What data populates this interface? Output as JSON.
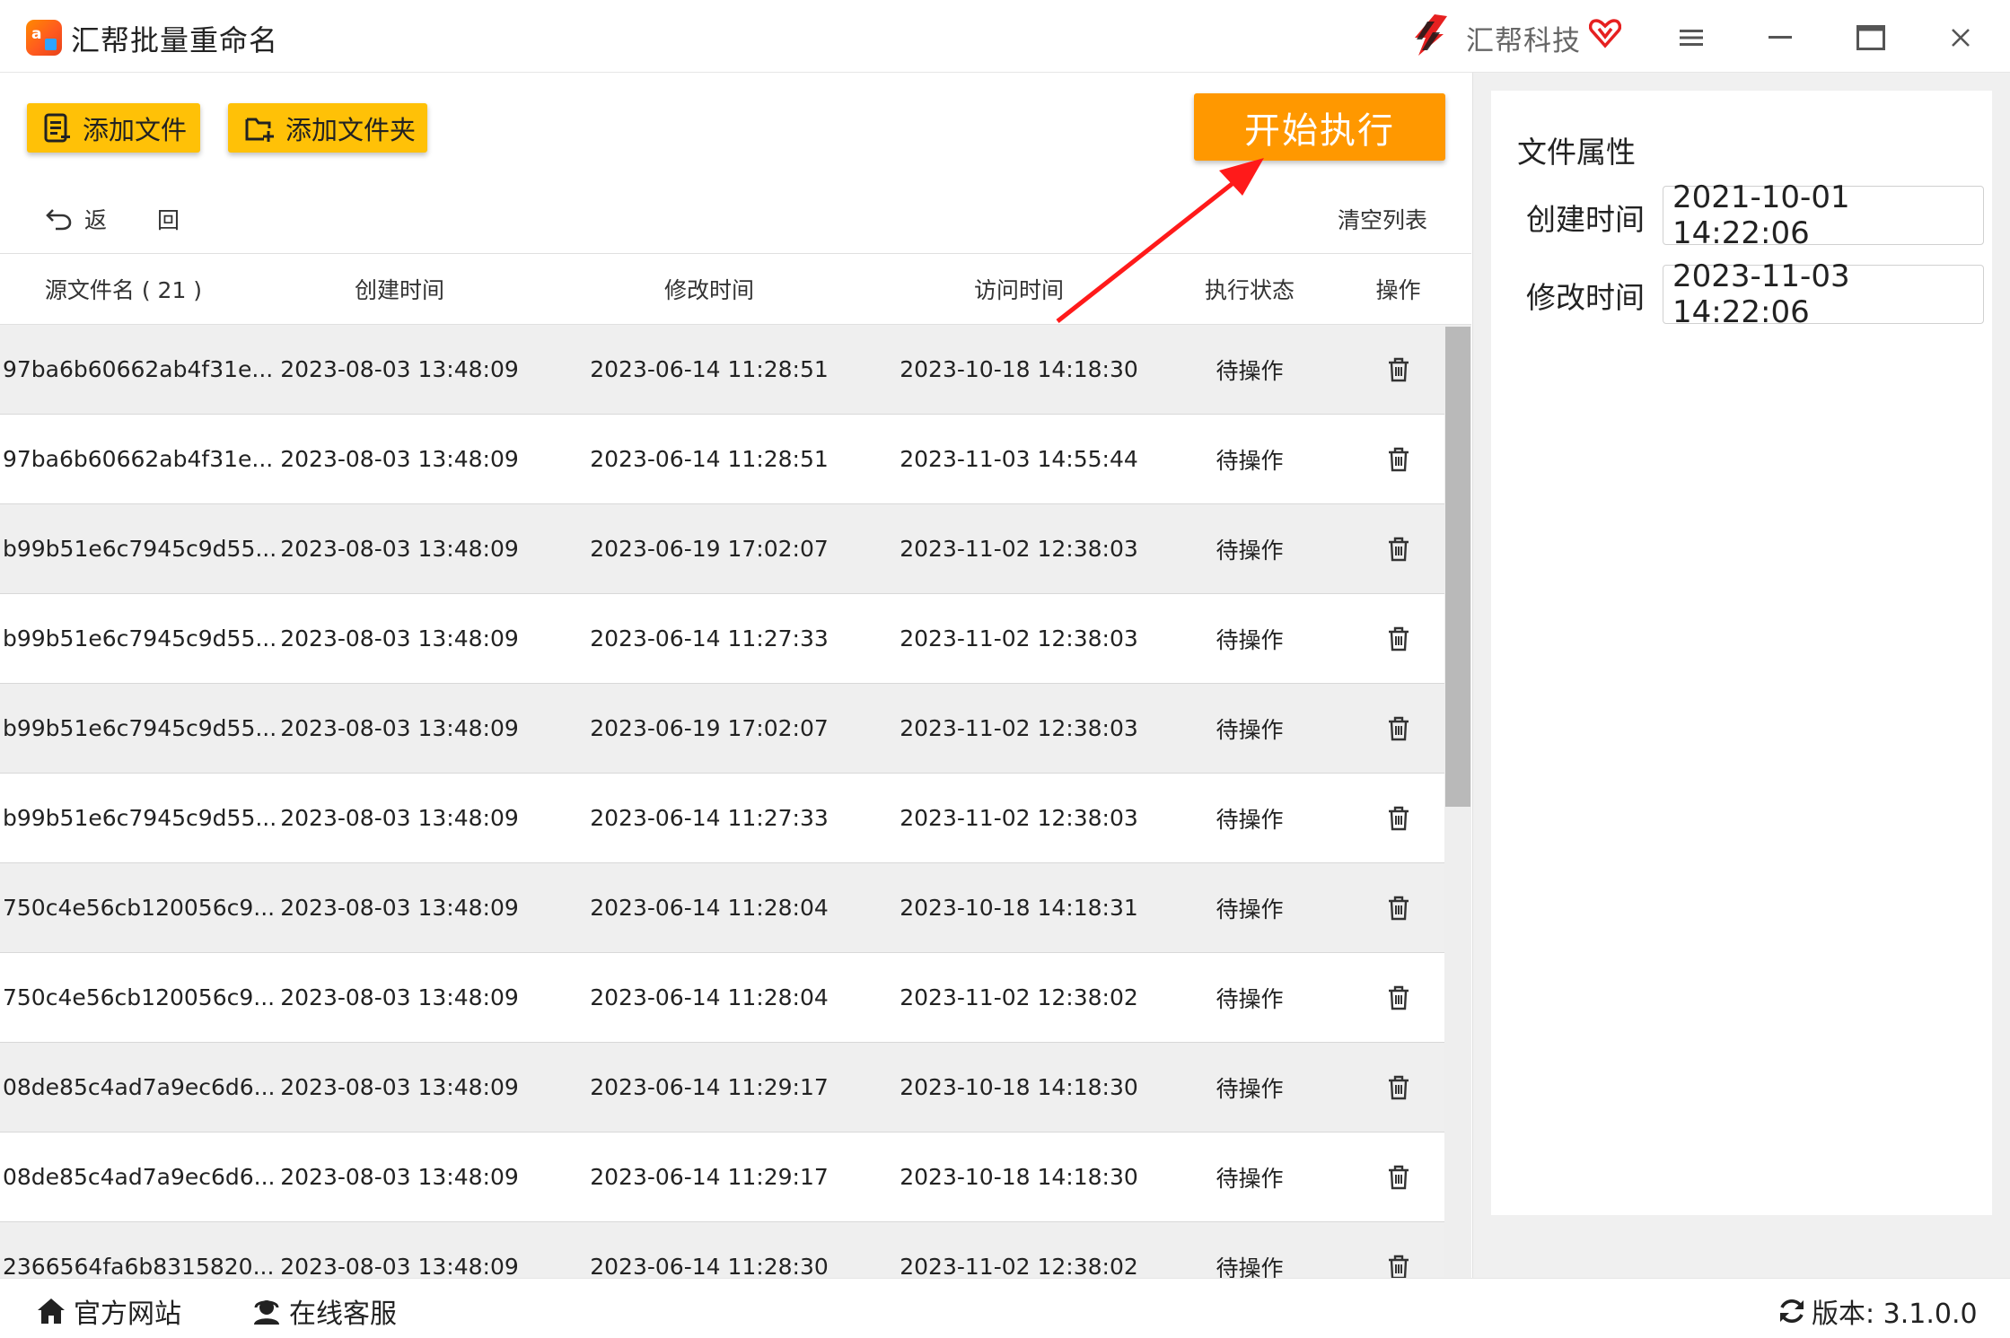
{
  "app": {
    "title": "汇帮批量重命名",
    "brand": "汇帮科技"
  },
  "toolbar": {
    "add_file": "添加文件",
    "add_folder": "添加文件夹",
    "start": "开始执行",
    "back": "返 回",
    "clear_list": "清空列表"
  },
  "table": {
    "columns": [
      "源文件名 ( 21 )",
      "创建时间",
      "修改时间",
      "访问时间",
      "执行状态",
      "操作"
    ],
    "rows": [
      {
        "name": "97ba6b60662ab4f31e...",
        "created": "2023-08-03 13:48:09",
        "modified": "2023-06-14 11:28:51",
        "accessed": "2023-10-18 14:18:30",
        "status": "待操作"
      },
      {
        "name": "97ba6b60662ab4f31e...",
        "created": "2023-08-03 13:48:09",
        "modified": "2023-06-14 11:28:51",
        "accessed": "2023-11-03 14:55:44",
        "status": "待操作"
      },
      {
        "name": "b99b51e6c7945c9d55...",
        "created": "2023-08-03 13:48:09",
        "modified": "2023-06-19 17:02:07",
        "accessed": "2023-11-02 12:38:03",
        "status": "待操作"
      },
      {
        "name": "b99b51e6c7945c9d55...",
        "created": "2023-08-03 13:48:09",
        "modified": "2023-06-14 11:27:33",
        "accessed": "2023-11-02 12:38:03",
        "status": "待操作"
      },
      {
        "name": "b99b51e6c7945c9d55...",
        "created": "2023-08-03 13:48:09",
        "modified": "2023-06-19 17:02:07",
        "accessed": "2023-11-02 12:38:03",
        "status": "待操作"
      },
      {
        "name": "b99b51e6c7945c9d55...",
        "created": "2023-08-03 13:48:09",
        "modified": "2023-06-14 11:27:33",
        "accessed": "2023-11-02 12:38:03",
        "status": "待操作"
      },
      {
        "name": "750c4e56cb120056c9...",
        "created": "2023-08-03 13:48:09",
        "modified": "2023-06-14 11:28:04",
        "accessed": "2023-10-18 14:18:31",
        "status": "待操作"
      },
      {
        "name": "750c4e56cb120056c9...",
        "created": "2023-08-03 13:48:09",
        "modified": "2023-06-14 11:28:04",
        "accessed": "2023-11-02 12:38:02",
        "status": "待操作"
      },
      {
        "name": "08de85c4ad7a9ec6d6...",
        "created": "2023-08-03 13:48:09",
        "modified": "2023-06-14 11:29:17",
        "accessed": "2023-10-18 14:18:30",
        "status": "待操作"
      },
      {
        "name": "08de85c4ad7a9ec6d6...",
        "created": "2023-08-03 13:48:09",
        "modified": "2023-06-14 11:29:17",
        "accessed": "2023-10-18 14:18:30",
        "status": "待操作"
      },
      {
        "name": "2366564fa6b8315820...",
        "created": "2023-08-03 13:48:09",
        "modified": "2023-06-14 11:28:30",
        "accessed": "2023-11-02 12:38:02",
        "status": "待操作"
      }
    ]
  },
  "properties": {
    "title": "文件属性",
    "created_label": "创建时间",
    "created_value": "2021-10-01 14:22:06",
    "modified_label": "修改时间",
    "modified_value": "2023-11-03 14:22:06"
  },
  "footer": {
    "website": "官方网站",
    "support": "在线客服",
    "version": "版本:  3.1.0.0"
  },
  "colors": {
    "accent_yellow": "#ffc107",
    "accent_orange": "#ff9800",
    "arrow_red": "#ff1a1a",
    "row_alt": "#efefef"
  },
  "icons": {
    "app": "app-logo-icon",
    "brand": "brand-logo-icon",
    "vip": "vip-heart-icon",
    "menu": "hamburger-menu-icon",
    "minimize": "minimize-icon",
    "maximize": "maximize-icon",
    "close": "close-icon",
    "add_file": "file-list-icon",
    "add_folder": "folder-plus-icon",
    "back": "undo-arrow-icon",
    "delete": "trash-icon",
    "home": "home-icon",
    "support": "headset-user-icon",
    "refresh": "refresh-icon"
  }
}
